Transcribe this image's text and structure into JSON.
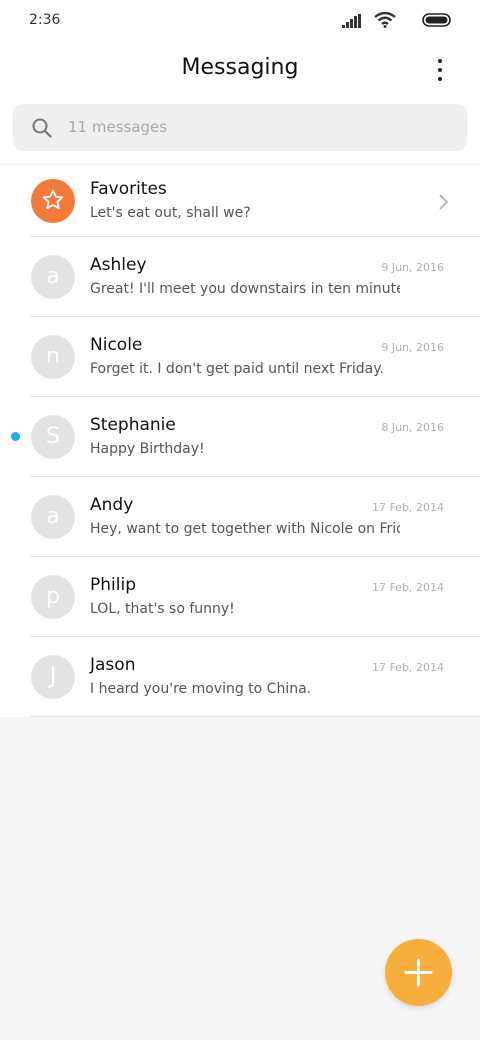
{
  "status_bar": {
    "time": "2:36"
  },
  "header": {
    "title": "Messaging",
    "more_icon": "more-vertical-icon"
  },
  "search": {
    "placeholder": "11 messages",
    "icon": "search-icon"
  },
  "favorites": {
    "name": "Favorites",
    "preview": "Let's eat out, shall we?",
    "icon": "star-icon",
    "color": "#f47a3a"
  },
  "conversations": [
    {
      "initial": "a",
      "name": "Ashley",
      "preview": "Great! I'll meet you downstairs in ten minutes. ...",
      "date": "9 Jun, 2016",
      "unread": false
    },
    {
      "initial": "n",
      "name": "Nicole",
      "preview": "Forget it. I don't get paid until next Friday.",
      "date": "9 Jun, 2016",
      "unread": false
    },
    {
      "initial": "S",
      "name": "Stephanie",
      "preview": "Happy Birthday!",
      "date": "8 Jun, 2016",
      "unread": true
    },
    {
      "initial": "a",
      "name": "Andy",
      "preview": "Hey, want to get together with Nicole on Friday?",
      "date": "17 Feb, 2014",
      "unread": false
    },
    {
      "initial": "p",
      "name": "Philip",
      "preview": "LOL, that's so funny!",
      "date": "17 Feb, 2014",
      "unread": false
    },
    {
      "initial": "J",
      "name": "Jason",
      "preview": "I heard you're moving to China.",
      "date": "17 Feb, 2014",
      "unread": false
    }
  ],
  "colors": {
    "accent_fab": "#f7ae3c",
    "unread_dot": "#2aa8f0",
    "avatar_bg": "#e3e3e3"
  },
  "fab": {
    "icon": "plus-icon"
  }
}
